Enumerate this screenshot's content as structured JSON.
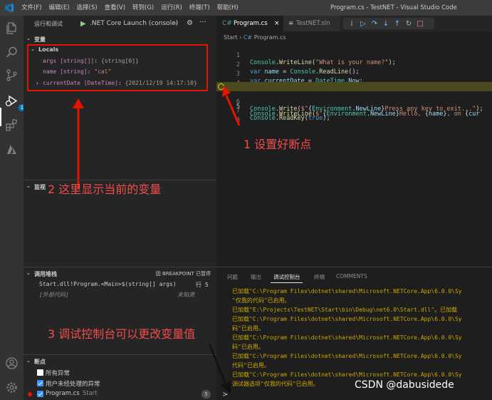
{
  "titlebar": {
    "menu": [
      "文件(F)",
      "编辑(E)",
      "选择(S)",
      "查看(V)",
      "转到(G)",
      "运行(R)",
      "终端(T)",
      "帮助(H)"
    ],
    "window_title": "Program.cs - TestNET - Visual Studio Code"
  },
  "activity": {
    "debug_badge": "1"
  },
  "run": {
    "header": "运行和调试",
    "config": ".NET Core Launch (console)"
  },
  "variables": {
    "title": "变量",
    "locals_label": "Locals",
    "items": [
      {
        "name": "args [string[]]",
        "value": "{string[0]}"
      },
      {
        "name": "name [string]",
        "value": "\"cal\""
      },
      {
        "name": "currentDate [DateTime]",
        "value": "{2021/12/19 14:17:10}"
      }
    ]
  },
  "watch": {
    "title": "监视"
  },
  "callstack": {
    "title": "调用堆栈",
    "status": "因 BREAKPOINT 已暂停",
    "frames": [
      {
        "text": "Start.dll!Program.<Main>$(string[] args)",
        "pos": "行 5"
      },
      {
        "text": "[外部代码]",
        "pos": "未知源"
      }
    ]
  },
  "breakpoints": {
    "title": "断点",
    "items": [
      {
        "label": "所有异常",
        "checked": false
      },
      {
        "label": "用户未经处理的异常",
        "checked": true
      }
    ],
    "file": {
      "name": "Program.cs",
      "folder": "Start",
      "count": "5"
    }
  },
  "annotations": {
    "a1": "1 设置好断点",
    "a2": "2 这里显示当前的变量",
    "a3": "3 调试控制台可以更改变量值"
  },
  "editor": {
    "tabs": [
      {
        "label": "Program.cs",
        "active": true
      },
      {
        "label": "TestNET.sln",
        "active": false
      }
    ],
    "breadcrumb_folder": "Start",
    "breadcrumb_file": "Program.cs",
    "line_numbers": [
      "1",
      "2",
      "3",
      "4",
      "5",
      "6",
      "7",
      "8"
    ]
  },
  "panel": {
    "tabs": [
      "问题",
      "输出",
      "调试控制台",
      "终端",
      "COMMENTS"
    ],
    "active_tab": "调试控制台",
    "output": [
      "已加载\"C:\\Program Files\\dotnet\\shared\\Microsoft.NETCore.App\\6.0.0\\Sy",
      "\"仅我的代码\"已启用。",
      "已加载\"E:\\Projects\\TestNET\\Start\\bin\\Debug\\net6.0\\Start.dll\"。已加载",
      "已加载\"C:\\Program Files\\dotnet\\shared\\Microsoft.NETCore.App\\6.0.0\\Sy",
      "码\"已启用。",
      "已加载\"C:\\Program Files\\dotnet\\shared\\Microsoft.NETCore.App\\6.0.0\\Sy",
      "码\"已启用。",
      "已加载\"C:\\Program Files\\dotnet\\shared\\Microsoft.NETCore.App\\6.0.0\\Sy",
      "代码\"已启用。",
      "已加载\"C:\\Program Files\\dotnet\\shared\\Microsoft.NETCore.App\\6.0.0\\Sy",
      "调试器选项\"仅我的代码\"已启用。"
    ],
    "prompt": ">"
  },
  "watermark": "CSDN @dabusidede"
}
